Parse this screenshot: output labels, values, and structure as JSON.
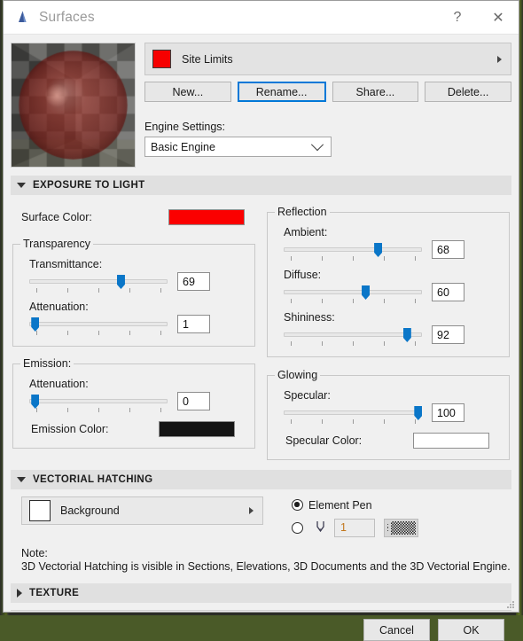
{
  "window": {
    "title": "Surfaces",
    "icon": "app-icon",
    "help_label": "?",
    "close_label": "✕"
  },
  "attribute": {
    "name": "Site Limits",
    "swatch_color": "#f60000",
    "popup_arrow": "triangle-right-icon"
  },
  "buttons": {
    "new": "New...",
    "rename": "Rename...",
    "share": "Share...",
    "delete": "Delete..."
  },
  "engine": {
    "label": "Engine Settings:",
    "value": "Basic Engine"
  },
  "sections": {
    "exposure": {
      "title": "EXPOSURE TO LIGHT",
      "expanded": true,
      "surface_color_label": "Surface Color:",
      "surface_color_value": "#fb0000",
      "transparency": {
        "legend": "Transparency",
        "sliders": [
          {
            "label": "Transmittance:",
            "value": "69",
            "percent": 66
          },
          {
            "label": "Attenuation:",
            "value": "1",
            "percent": 4
          }
        ]
      },
      "reflection": {
        "legend": "Reflection",
        "sliders": [
          {
            "label": "Ambient:",
            "value": "68",
            "percent": 68
          },
          {
            "label": "Diffuse:",
            "value": "60",
            "percent": 59
          },
          {
            "label": "Shininess:",
            "value": "92",
            "percent": 89
          }
        ]
      },
      "emission": {
        "legend": "Emission:",
        "sliders": [
          {
            "label": "Attenuation:",
            "value": "0",
            "percent": 4
          }
        ],
        "color_label": "Emission Color:",
        "color_value": "#151515"
      },
      "glowing": {
        "legend": "Glowing",
        "sliders": [
          {
            "label": "Specular:",
            "value": "100",
            "percent": 97
          }
        ],
        "color_label": "Specular Color:",
        "color_value": "#ffffff"
      }
    },
    "hatching": {
      "title": "VECTORIAL HATCHING",
      "expanded": true,
      "fill_name": "Background",
      "fill_swatch": "#ffffff",
      "element_pen_label": "Element Pen",
      "element_pen_selected": true,
      "custom_pen_selected": false,
      "pen_number": "1",
      "pen_number_color": "#c2761b",
      "note_label": "Note:",
      "note_text": "3D Vectorial Hatching is visible in Sections, Elevations, 3D Documents and the 3D Vectorial Engine."
    },
    "texture": {
      "title": "TEXTURE",
      "expanded": false
    }
  },
  "footer": {
    "cancel": "Cancel",
    "ok": "OK"
  }
}
